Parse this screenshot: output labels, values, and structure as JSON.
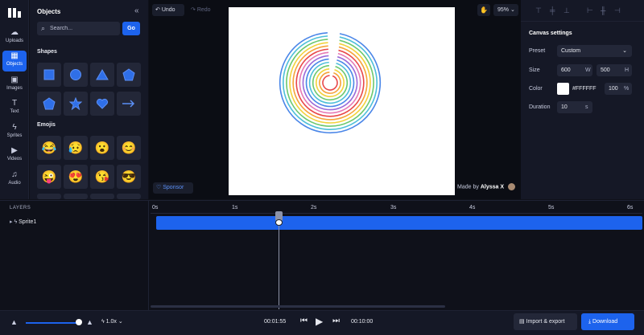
{
  "rail": {
    "logo": "bars-logo-icon",
    "items": [
      {
        "label": "Uploads",
        "icon": "cloud-upload-icon",
        "glyph": "☁"
      },
      {
        "label": "Objects",
        "icon": "grid-icon",
        "glyph": "▦",
        "active": true
      },
      {
        "label": "Images",
        "icon": "image-icon",
        "glyph": "▣"
      },
      {
        "label": "Text",
        "icon": "text-icon",
        "glyph": "T"
      },
      {
        "label": "Sprites",
        "icon": "bolt-icon",
        "glyph": "ϟ"
      },
      {
        "label": "Videos",
        "icon": "video-icon",
        "glyph": "▶"
      },
      {
        "label": "Audio",
        "icon": "music-icon",
        "glyph": "♫"
      }
    ]
  },
  "objects_panel": {
    "title": "Objects",
    "search_placeholder": "Search...",
    "go_label": "Go",
    "shapes_title": "Shapes",
    "emojis_title": "Emojis",
    "shapes": [
      "square",
      "circle",
      "triangle",
      "pentagon",
      "pentagon-outline",
      "star",
      "heart",
      "arrow"
    ],
    "emojis": [
      "😂",
      "😥",
      "😮",
      "😊",
      "😜",
      "😍",
      "😘",
      "😎"
    ]
  },
  "stage": {
    "undo_label": "Undo",
    "redo_label": "Redo",
    "zoom_label": "95%",
    "sponsor_label": "Sponsor",
    "made_by_prefix": "Made by",
    "made_by_name": "Alyssa X"
  },
  "canvas_settings": {
    "title": "Canvas settings",
    "preset_label": "Preset",
    "preset_value": "Custom",
    "size_label": "Size",
    "width_value": "600",
    "width_unit": "W",
    "height_value": "500",
    "height_unit": "H",
    "color_label": "Color",
    "color_value": "#FFFFFF",
    "opacity_value": "100",
    "opacity_unit": "%",
    "duration_label": "Duration",
    "duration_value": "10",
    "duration_unit": "s"
  },
  "timeline": {
    "layers_header": "LAYERS",
    "layer_name": "Sprite1",
    "ticks": [
      "0s",
      "1s",
      "2s",
      "3s",
      "4s",
      "5s",
      "6s"
    ]
  },
  "playback": {
    "speed_label": "1.0x",
    "current_time": "00:01:55",
    "end_time": "00:10:00",
    "import_label": "Import & export",
    "download_label": "Download"
  },
  "colors": {
    "accent": "#1d63ed",
    "spiral": [
      "#e8484a",
      "#f5a33a",
      "#f2d23c",
      "#6cc86e",
      "#4dbfd8",
      "#4a86e8",
      "#9b6ad8",
      "#e67ab5"
    ]
  }
}
